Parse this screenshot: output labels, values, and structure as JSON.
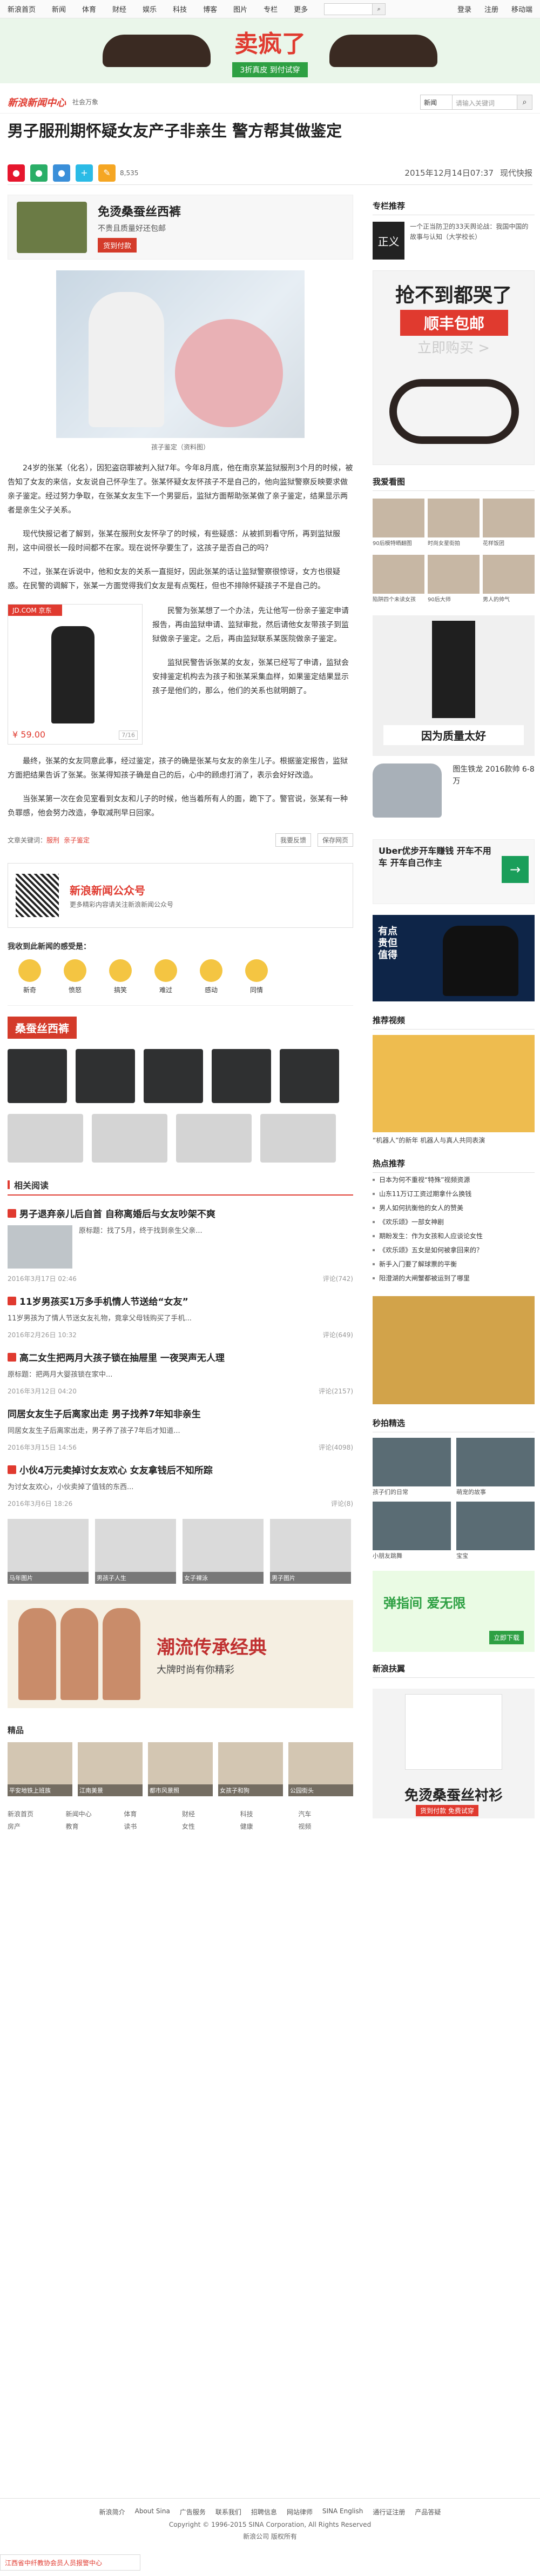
{
  "top_nav": {
    "items": [
      "新浪首页",
      "新闻",
      "体育",
      "财经",
      "娱乐",
      "科技",
      "博客",
      "图片",
      "专栏",
      "更多"
    ],
    "right": [
      "登录",
      "注册",
      "移动端"
    ],
    "search_placeholder": ""
  },
  "banner": {
    "title": "卖疯了",
    "subtitle": "3折真皮 到付试穿"
  },
  "header": {
    "logo": "新浪新闻中心",
    "channel": "社会万象",
    "search_select": "新闻",
    "search_placeholder": "请输入关键词"
  },
  "article": {
    "title": "男子服刑期怀疑女友产子非亲生 警方帮其做鉴定",
    "share_count": "8,535",
    "time": "2015年12月14日07:37",
    "source": "现代快报",
    "photo_caption": "孩子鉴定（资料图）",
    "paragraphs": [
      "24岁的张某（化名），因犯盗窃罪被判入狱7年。今年8月底，他在南京某监狱服刑3个月的时候，被告知了女友的来信，女友说自己怀孕生了。张某怀疑女友怀孩子不是自己的，他向监狱警察反映要求做亲子鉴定。经过努力争取，在张某女友生下一个男婴后，监狱方面帮助张某做了亲子鉴定，结果显示两者是亲生父子关系。",
      "现代快报记者了解到，张某在服刑女友怀孕了的时候，有些疑惑：从被抓到看守所，再到监狱服刑，这中间很长一段时间都不在家。现在说怀孕要生了，这孩子是否自己的吗？",
      "不过，张某在诉说中，他和女友的关系一直挺好，因此张某的话让监狱警察很惊讶，女方也很疑惑。在民警的调解下，张某一方面觉得我们女友是有点冤枉，但也不排除怀疑孩子不是自己的。",
      "民警为张某想了一个办法，先让他写一份亲子鉴定申请报告，再由监狱申请、监狱审批，然后请他女友带孩子到监狱做亲子鉴定。之后，再由监狱联系某医院做亲子鉴定。",
      "监狱民警告诉张某的女友，张某已经写了申请，监狱会安排鉴定机构去为孩子和张某采集血样，如果鉴定结果显示孩子是他们的，那么，他们的关系也就明朗了。",
      "最终，张某的女友同意此事，经过鉴定，孩子的确是张某与女友的亲生儿子。根据鉴定报告，监狱方面把结果告诉了张某。张某得知孩子确是自己的后，心中的顾虑打消了，表示会好好改造。",
      "当张某第一次在会见室看到女友和儿子的时候，他当着所有人的面，跪下了。警官说，张某有一种负罪感，他会努力改造，争取减刑早日回家。"
    ],
    "inline_ad": {
      "label": "JD.COM 京东",
      "price": "¥ 59.00",
      "page": "7/16"
    },
    "tags_label": "文章关键词：",
    "tags": [
      "服刑",
      "亲子鉴定"
    ],
    "actions": [
      "我要反馈",
      "保存网页"
    ]
  },
  "wechat": {
    "title": "新浪新闻公众号",
    "desc": "更多精彩内容请关注新浪新闻公众号"
  },
  "mood": {
    "heading": "我收到此新闻的感受是：",
    "faces": [
      "新奇",
      "愤怒",
      "搞笑",
      "难过",
      "感动",
      "同情"
    ]
  },
  "silk_ad": {
    "title": "桑蚕丝西裤"
  },
  "related": {
    "heading": "相关阅读",
    "items": [
      {
        "title": "男子退弃亲儿后自首 自称离婚后与女友吵架不爽",
        "desc": "原标题：找了5月，终于找到亲生父亲...",
        "time": "2016年3月17日 02:46",
        "comment": "评论(742)"
      },
      {
        "title": "11岁男孩买1万多手机情人节送给“女友”",
        "desc": "11岁男孩为了情人节送女友礼物，竟拿父母钱购买了手机...",
        "time": "2016年2月26日 10:32",
        "comment": "评论(649)"
      },
      {
        "title": "高二女生把两月大孩子锁在抽屉里 一夜哭声无人理",
        "desc": "原标题：把两月大婴孩锁在家中...",
        "time": "2016年3月12日 04:20",
        "comment": "评论(2157)"
      },
      {
        "title": "同居女友生子后离家出走 男子找养7年知非亲生",
        "desc": "同居女友生子后离家出走，男子养了孩子7年后才知道...",
        "time": "2016年3月15日 14:56",
        "comment": "评论(4098)"
      },
      {
        "title": "小伙4万元卖掉讨女友欢心 女友拿钱后不知所踪",
        "desc": "为讨女友欢心，小伙卖掉了值钱的东西...",
        "time": "2016年3月6日 18:26",
        "comment": "评论(8)"
      }
    ]
  },
  "pics": {
    "items": [
      "马年图片",
      "男孩子人生",
      "女子裸泳",
      "男子图片"
    ]
  },
  "fashion_ad": {
    "title": "潮流传承经典",
    "subtitle": "大牌时尚有你精彩"
  },
  "boutique": {
    "heading": "精品",
    "items": [
      "平安地铁上班族",
      "江南美景",
      "都市风景照",
      "女孩子和狗",
      "公园街头"
    ]
  },
  "navlinks": [
    "新浪首页",
    "新闻中心",
    "体育",
    "财经",
    "科技",
    "汽车",
    "房产",
    "教育",
    "读书",
    "女性",
    "健康",
    "视频"
  ],
  "sidebar": {
    "rec_heading": "专栏推荐",
    "rec": {
      "img": "正义",
      "text": "一个正当防卫的33天舆论战：我国中国的故事与认知（大学校长）"
    },
    "belt_ad": {
      "title": "抢不到都哭了",
      "tag": "顺丰包邮",
      "sub": "立即购买 >"
    },
    "photo_heading": "我爱看图",
    "photos": [
      "90后模特晒翻图",
      "时尚女星街拍",
      "花样饭团",
      "陷阱四个未读女孩",
      "90后大师",
      "男人的帅气"
    ],
    "pants_ad": {
      "title": "因为质量太好"
    },
    "car_ad": {
      "text": "图生铁龙 2016款帅 6-8万"
    },
    "uber": {
      "title": "Uber优步开车赚钱 开车不用车 开车自己作主",
      "btn": "→"
    },
    "polo": {
      "title": "有点贵但值得"
    },
    "video_heading": "推荐视频",
    "video_cap": "“机器人”的新年 机器人与真人共同表演",
    "hot_heading": "热点推荐",
    "hot_items": [
      "日本为何不重视“特殊”视频资源",
      "山东11万订工资过期拿什么换钱",
      "男人如何抗衡他的女人的赞美",
      "《欢乐颂》一部女神剧",
      "期盼发生：作为女孩和人应谈论女性",
      "《欢乐颂》五女是如何被拿回来的？",
      "新手入门要了解球票的平衡",
      "阳澄湖的大闸蟹都被运到了哪里"
    ],
    "sec_video_heading": "秒拍精选",
    "sec_videos": [
      "孩子们的日常",
      "萌宠的故事",
      "小朋友跳舞",
      "宝宝"
    ],
    "app_ad": {
      "title": "弹指间 爱无限",
      "btn": "立即下载"
    },
    "shirt_heading": "新浪扶翼",
    "shirt_ad": {
      "title": "免烫桑蚕丝衬衫",
      "btn": "货到付款 免费试穿"
    }
  },
  "footer": {
    "links": [
      "新浪简介",
      "About Sina",
      "广告服务",
      "联系我们",
      "招聘信息",
      "网站律师",
      "SINA English",
      "通行证注册",
      "产品答疑"
    ],
    "copyright": "Copyright © 1996-2015 SINA Corporation, All Rights Reserved",
    "rights": "新浪公司 版权所有",
    "police": "江西省中纤教协会员人员报警中心"
  }
}
